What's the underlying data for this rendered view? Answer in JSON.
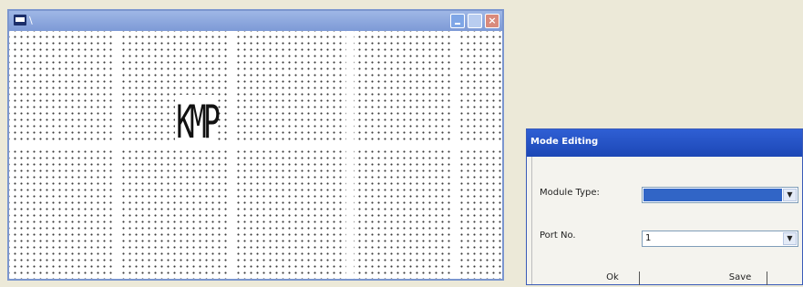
{
  "main_window": {
    "title": "",
    "title_mark": "\\",
    "grid_text": "KMP",
    "close_glyph": "×"
  },
  "dialog": {
    "title": "Mode Editing",
    "field1": {
      "label": "Module Type:",
      "value": ""
    },
    "field2": {
      "label": "Port No.",
      "value": "1"
    },
    "ok_label": "Ok",
    "save_label": "Save",
    "arrow_glyph": "▼"
  },
  "colors": {
    "titlebar_main": "#7d9ad6",
    "titlebar_dialog": "#1c47b5",
    "selection": "#3165c6",
    "desktop": "#ece9d8"
  }
}
